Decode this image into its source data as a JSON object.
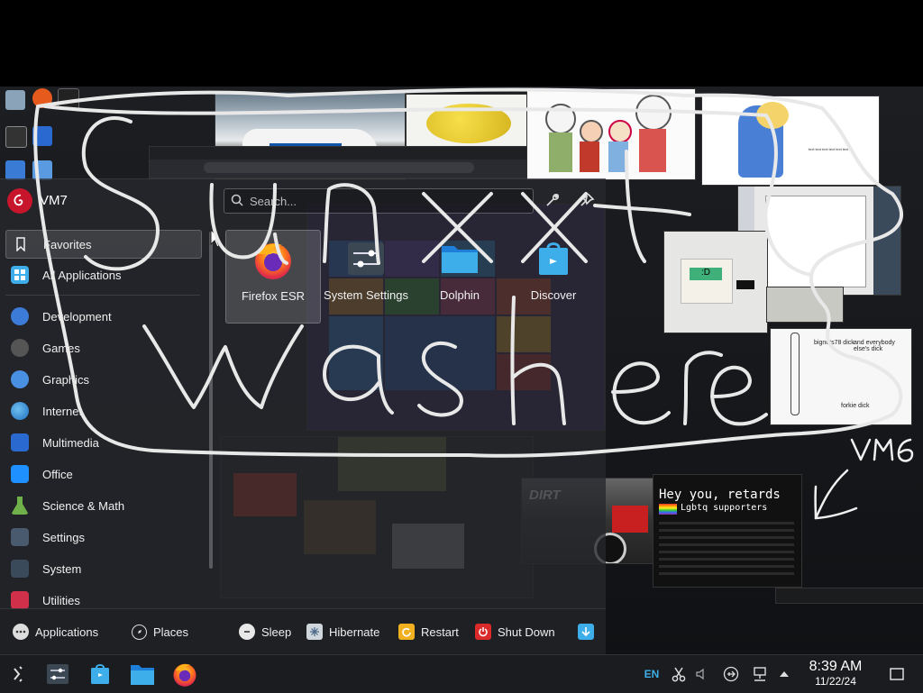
{
  "launcher": {
    "user_name": "VM7",
    "search_placeholder": "Search...",
    "categories": [
      {
        "label": "Favorites",
        "icon": "bookmark-icon"
      },
      {
        "label": "All Applications",
        "icon": "grid-icon"
      },
      {
        "label": "Development",
        "icon": "development-icon"
      },
      {
        "label": "Games",
        "icon": "gamepad-icon"
      },
      {
        "label": "Graphics",
        "icon": "graphics-icon"
      },
      {
        "label": "Internet",
        "icon": "globe-icon"
      },
      {
        "label": "Multimedia",
        "icon": "multimedia-icon"
      },
      {
        "label": "Office",
        "icon": "office-icon"
      },
      {
        "label": "Science & Math",
        "icon": "flask-icon"
      },
      {
        "label": "Settings",
        "icon": "settings-icon"
      },
      {
        "label": "System",
        "icon": "system-icon"
      },
      {
        "label": "Utilities",
        "icon": "utilities-icon"
      }
    ],
    "apps": [
      {
        "label": "Firefox ESR",
        "icon": "firefox-icon"
      },
      {
        "label": "System Settings",
        "icon": "system-settings-icon"
      },
      {
        "label": "Dolphin",
        "icon": "folder-icon"
      },
      {
        "label": "Discover",
        "icon": "discover-icon"
      }
    ],
    "footer": {
      "applications": "Applications",
      "places": "Places",
      "sleep": "Sleep",
      "hibernate": "Hibernate",
      "restart": "Restart",
      "shutdown": "Shut Down"
    }
  },
  "taskbar": {
    "keyboard_layout": "EN",
    "time": "8:39 AM",
    "date": "11/22/24"
  },
  "overlay": {
    "meme_title": "Hey you, retards",
    "meme_subtitle": "Lgbtq supporters",
    "drawing_text_1": "bignuts78 dick",
    "drawing_text_2": "and everybody else's dick",
    "drawing_text_3": "forkie dick"
  },
  "colors": {
    "accent": "#3daee9",
    "debian_red": "#c7162b",
    "doodle": "#e8e8e8"
  }
}
